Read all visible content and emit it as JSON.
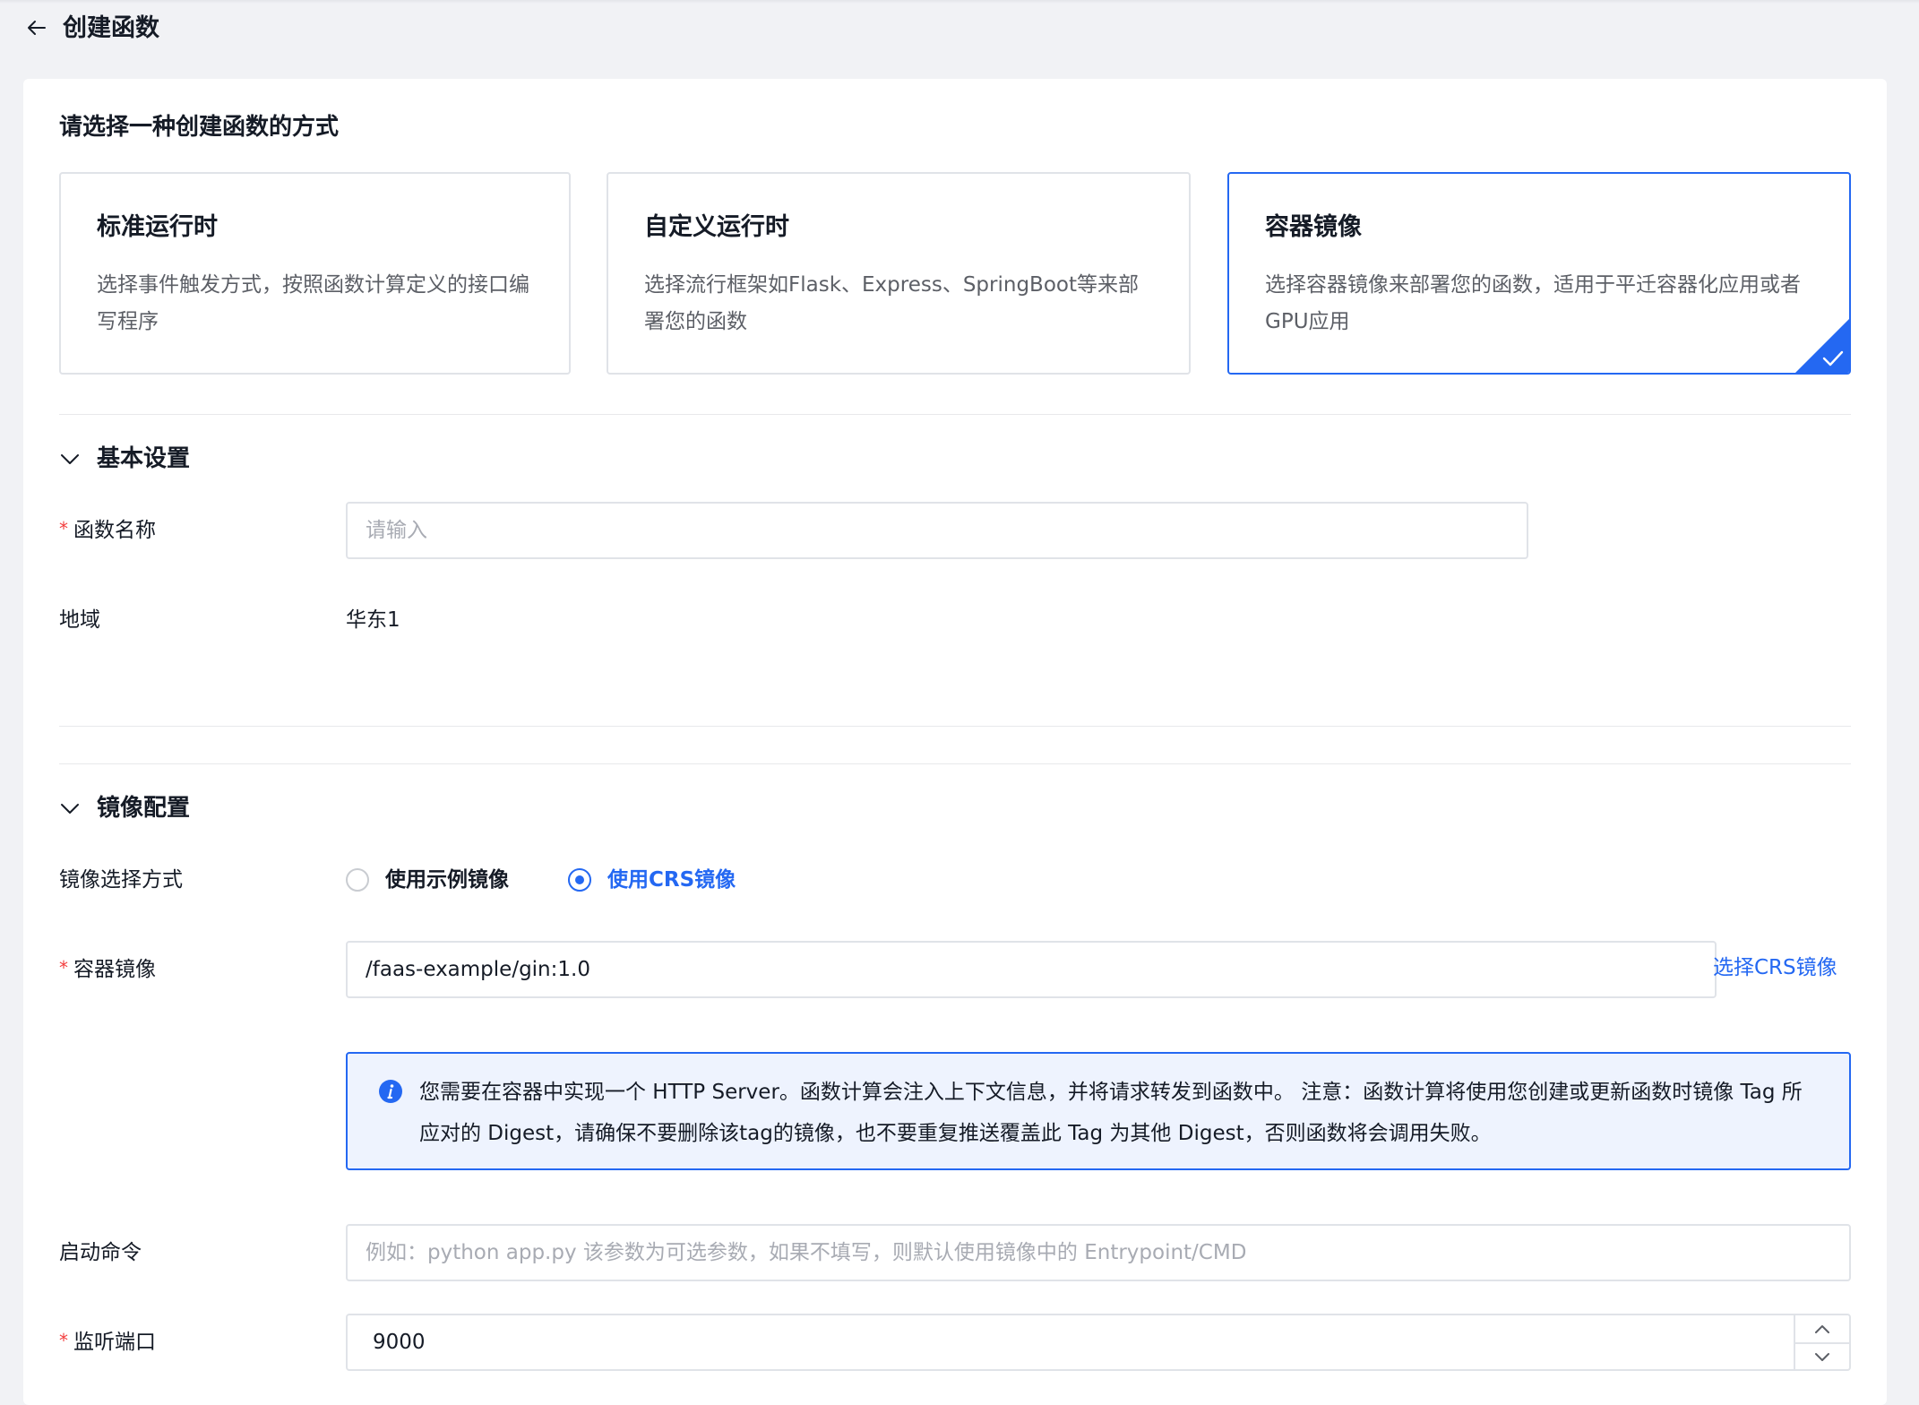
{
  "header": {
    "title": "创建函数",
    "back_icon": "arrow-left-icon"
  },
  "creation": {
    "prompt": "请选择一种创建函数的方式",
    "options": [
      {
        "title": "标准运行时",
        "desc": "选择事件触发方式，按照函数计算定义的接口编写程序",
        "selected": false
      },
      {
        "title": "自定义运行时",
        "desc": "选择流行框架如Flask、Express、SpringBoot等来部署您的函数",
        "selected": false
      },
      {
        "title": "容器镜像",
        "desc": "选择容器镜像来部署您的函数，适用于平迁容器化应用或者GPU应用",
        "selected": true
      }
    ]
  },
  "basic": {
    "section_label": "基本设置",
    "name_label": "函数名称",
    "name_placeholder": "请输入",
    "region_label": "地域",
    "region_value": "华东1"
  },
  "image": {
    "section_label": "镜像配置",
    "mode_label": "镜像选择方式",
    "mode_options": [
      {
        "label": "使用示例镜像",
        "checked": false
      },
      {
        "label": "使用CRS镜像",
        "checked": true
      }
    ],
    "container_label": "容器镜像",
    "container_value": "/faas-example/gin:1.0",
    "select_link": "选择CRS镜像",
    "notice": "您需要在容器中实现一个 HTTP Server。函数计算会注入上下文信息，并将请求转发到函数中。 注意：函数计算将使用您创建或更新函数时镜像 Tag 所应对的 Digest，请确保不要删除该tag的镜像，也不要重复推送覆盖此 Tag 为其他 Digest，否则函数将会调用失败。",
    "cmd_label": "启动命令",
    "cmd_placeholder": "例如：python app.py 该参数为可选参数，如果不填写，则默认使用镜像中的 Entrypoint/CMD",
    "port_label": "监听端口",
    "port_value": "9000"
  },
  "required_mark": "*",
  "colors": {
    "accent": "#2468f2",
    "required": "#f33e3e",
    "notice_bg": "#eef3fe"
  }
}
